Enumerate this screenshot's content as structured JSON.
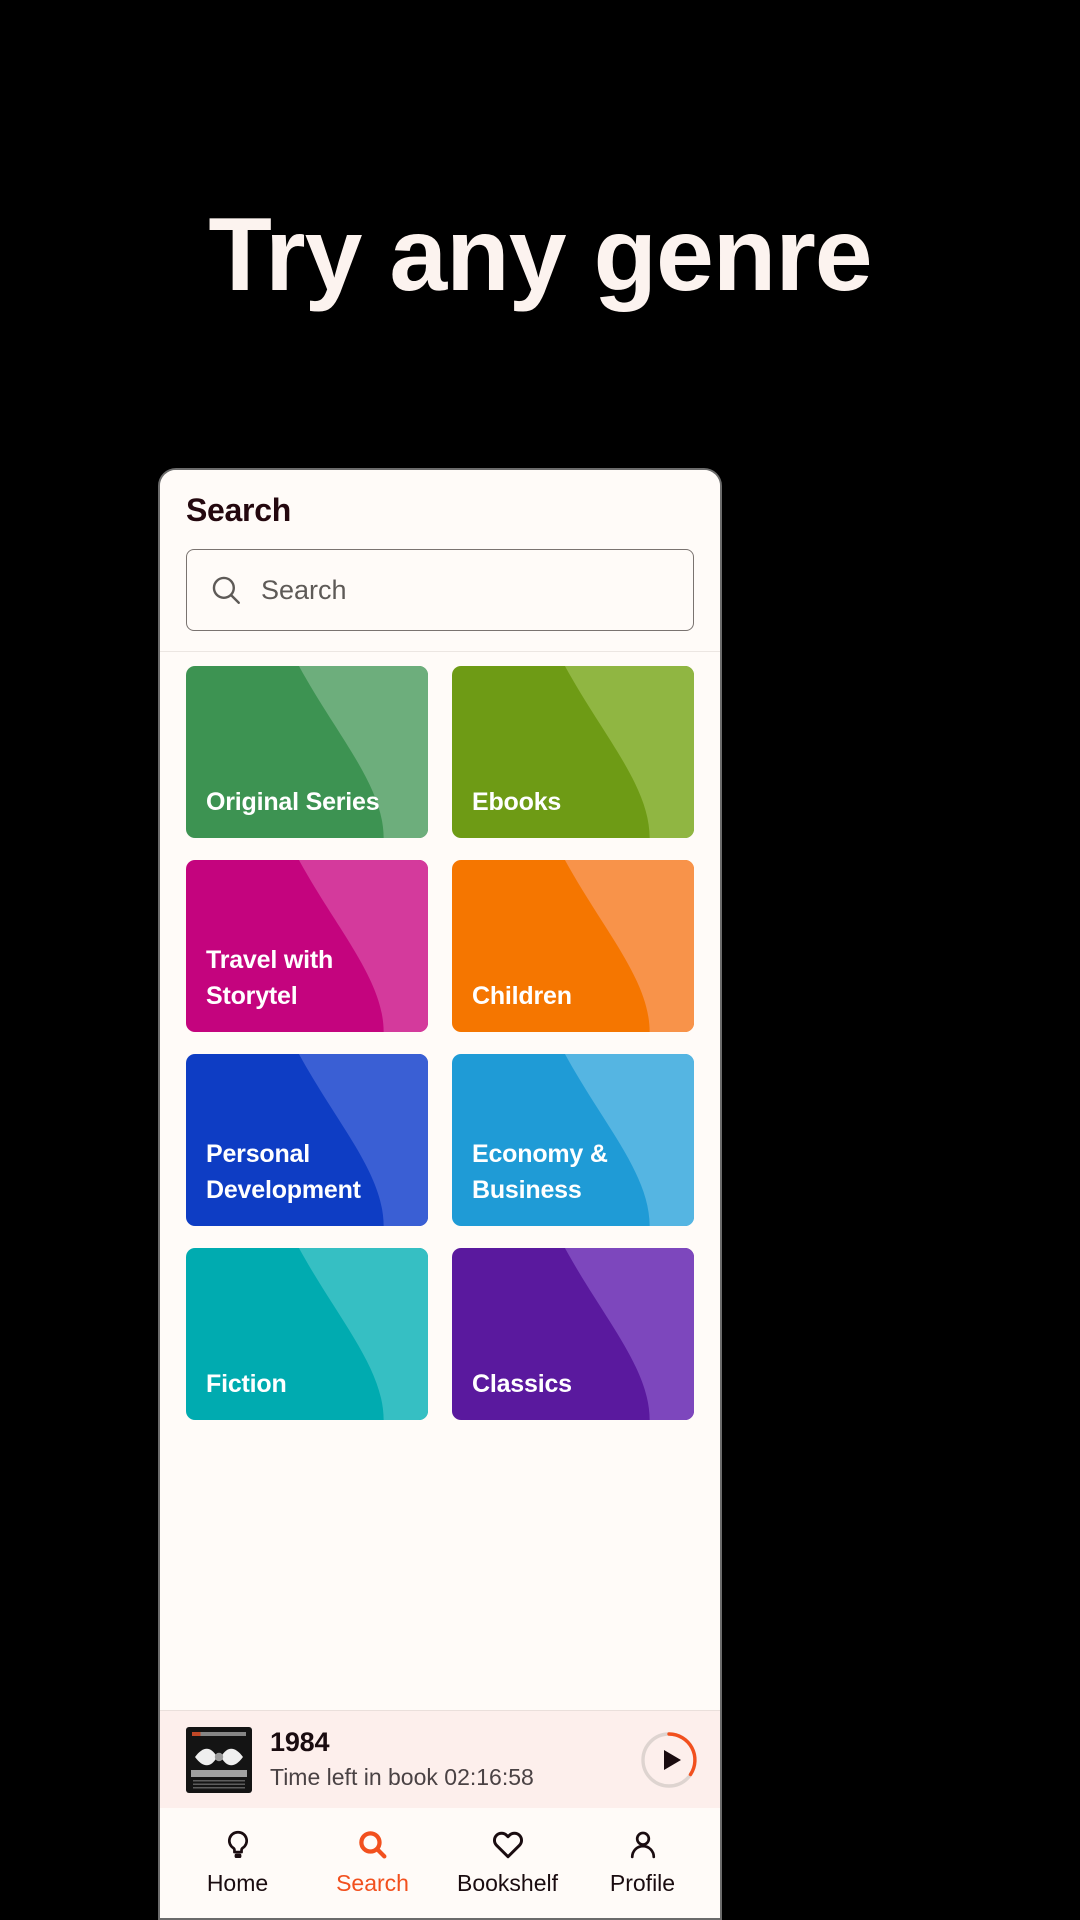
{
  "hero": {
    "title": "Try any genre",
    "text_color": "#FCF3EF",
    "background": "#000000"
  },
  "app": {
    "header": {
      "title": "Search"
    },
    "search": {
      "placeholder": "Search",
      "value": "",
      "icon": "search-icon"
    },
    "genres": [
      {
        "label": "Original Series",
        "base_color": "#3D9352",
        "wave_color": "#6DAE7C"
      },
      {
        "label": "Ebooks",
        "base_color": "#6E9B15",
        "wave_color": "#90B642"
      },
      {
        "label": "Travel with Storytel",
        "base_color": "#C4047E",
        "wave_color": "#D43A9C"
      },
      {
        "label": "Children",
        "base_color": "#F57600",
        "wave_color": "#F8934A"
      },
      {
        "label": "Personal Development",
        "base_color": "#0E3DC4",
        "wave_color": "#3A5FD4"
      },
      {
        "label": "Economy & Business",
        "base_color": "#1F9BD6",
        "wave_color": "#55B5E2"
      },
      {
        "label": "Fiction",
        "base_color": "#00ABB0",
        "wave_color": "#36BFC3"
      },
      {
        "label": "Classics",
        "base_color": "#5A199E",
        "wave_color": "#7D47BD"
      }
    ],
    "player": {
      "title": "1984",
      "subtitle": "Time left in book 02:16:58",
      "cover_alt": "1984-book-cover",
      "play_icon": "play-icon",
      "progress_color": "#F2501E",
      "background": "#FDEFEC"
    },
    "nav": {
      "active_color": "#F2501E",
      "items": [
        {
          "label": "Home",
          "icon": "lightbulb-icon",
          "active": false
        },
        {
          "label": "Search",
          "icon": "search-icon",
          "active": true
        },
        {
          "label": "Bookshelf",
          "icon": "heart-icon",
          "active": false
        },
        {
          "label": "Profile",
          "icon": "person-icon",
          "active": false
        }
      ]
    }
  }
}
